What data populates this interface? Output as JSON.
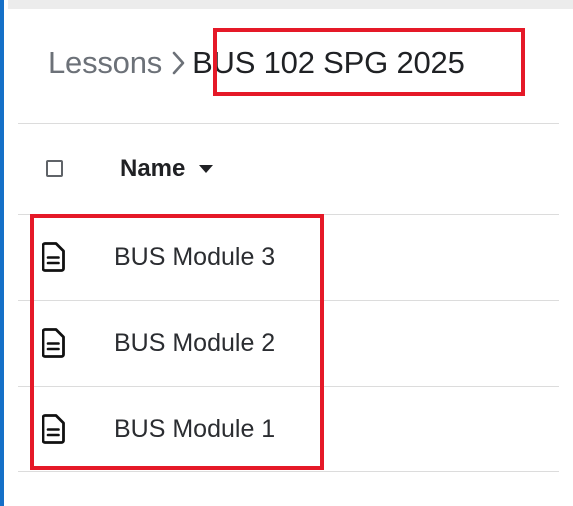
{
  "breadcrumb": {
    "parent": "Lessons",
    "current": "BUS 102 SPG 2025"
  },
  "table": {
    "column_header": "Name",
    "rows": [
      {
        "label": "BUS Module 3",
        "icon": "document-icon"
      },
      {
        "label": "BUS Module 2",
        "icon": "document-icon"
      },
      {
        "label": "BUS Module 1",
        "icon": "document-icon"
      }
    ]
  },
  "colors": {
    "highlight": "#e51928",
    "accent_border": "#1570c8",
    "text": "#202124",
    "muted": "#6c7178"
  }
}
